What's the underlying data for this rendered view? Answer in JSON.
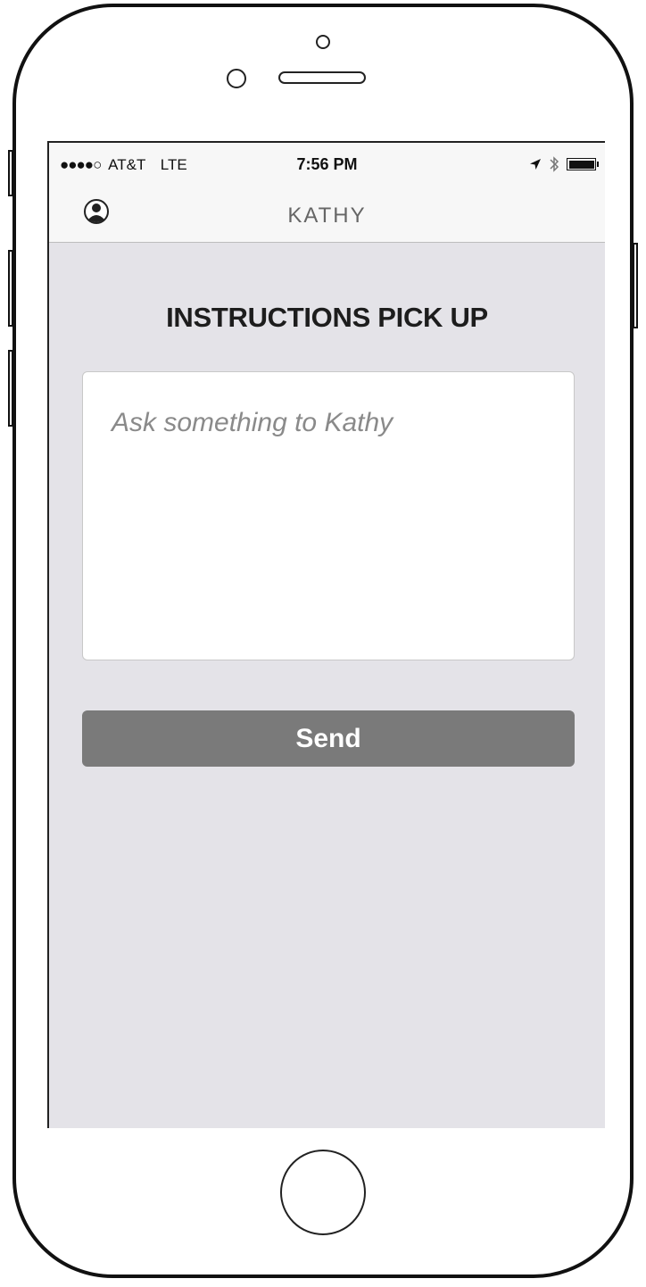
{
  "status_bar": {
    "signal": "●●●●○",
    "carrier": "AT&T",
    "network": "LTE",
    "time": "7:56 PM",
    "icons": [
      "location-arrow-icon",
      "bluetooth-icon",
      "battery-icon"
    ],
    "battery_level": 1.0
  },
  "navbar": {
    "title": "KATHY",
    "left_icon": "user-profile-icon"
  },
  "main": {
    "heading": "INSTRUCTIONS PICK UP",
    "message_placeholder": "Ask something to Kathy",
    "send_label": "Send"
  },
  "colors": {
    "screen_bg": "#e4e3e8",
    "button_bg": "#7a7a7a",
    "nav_bg": "#f7f7f7"
  }
}
